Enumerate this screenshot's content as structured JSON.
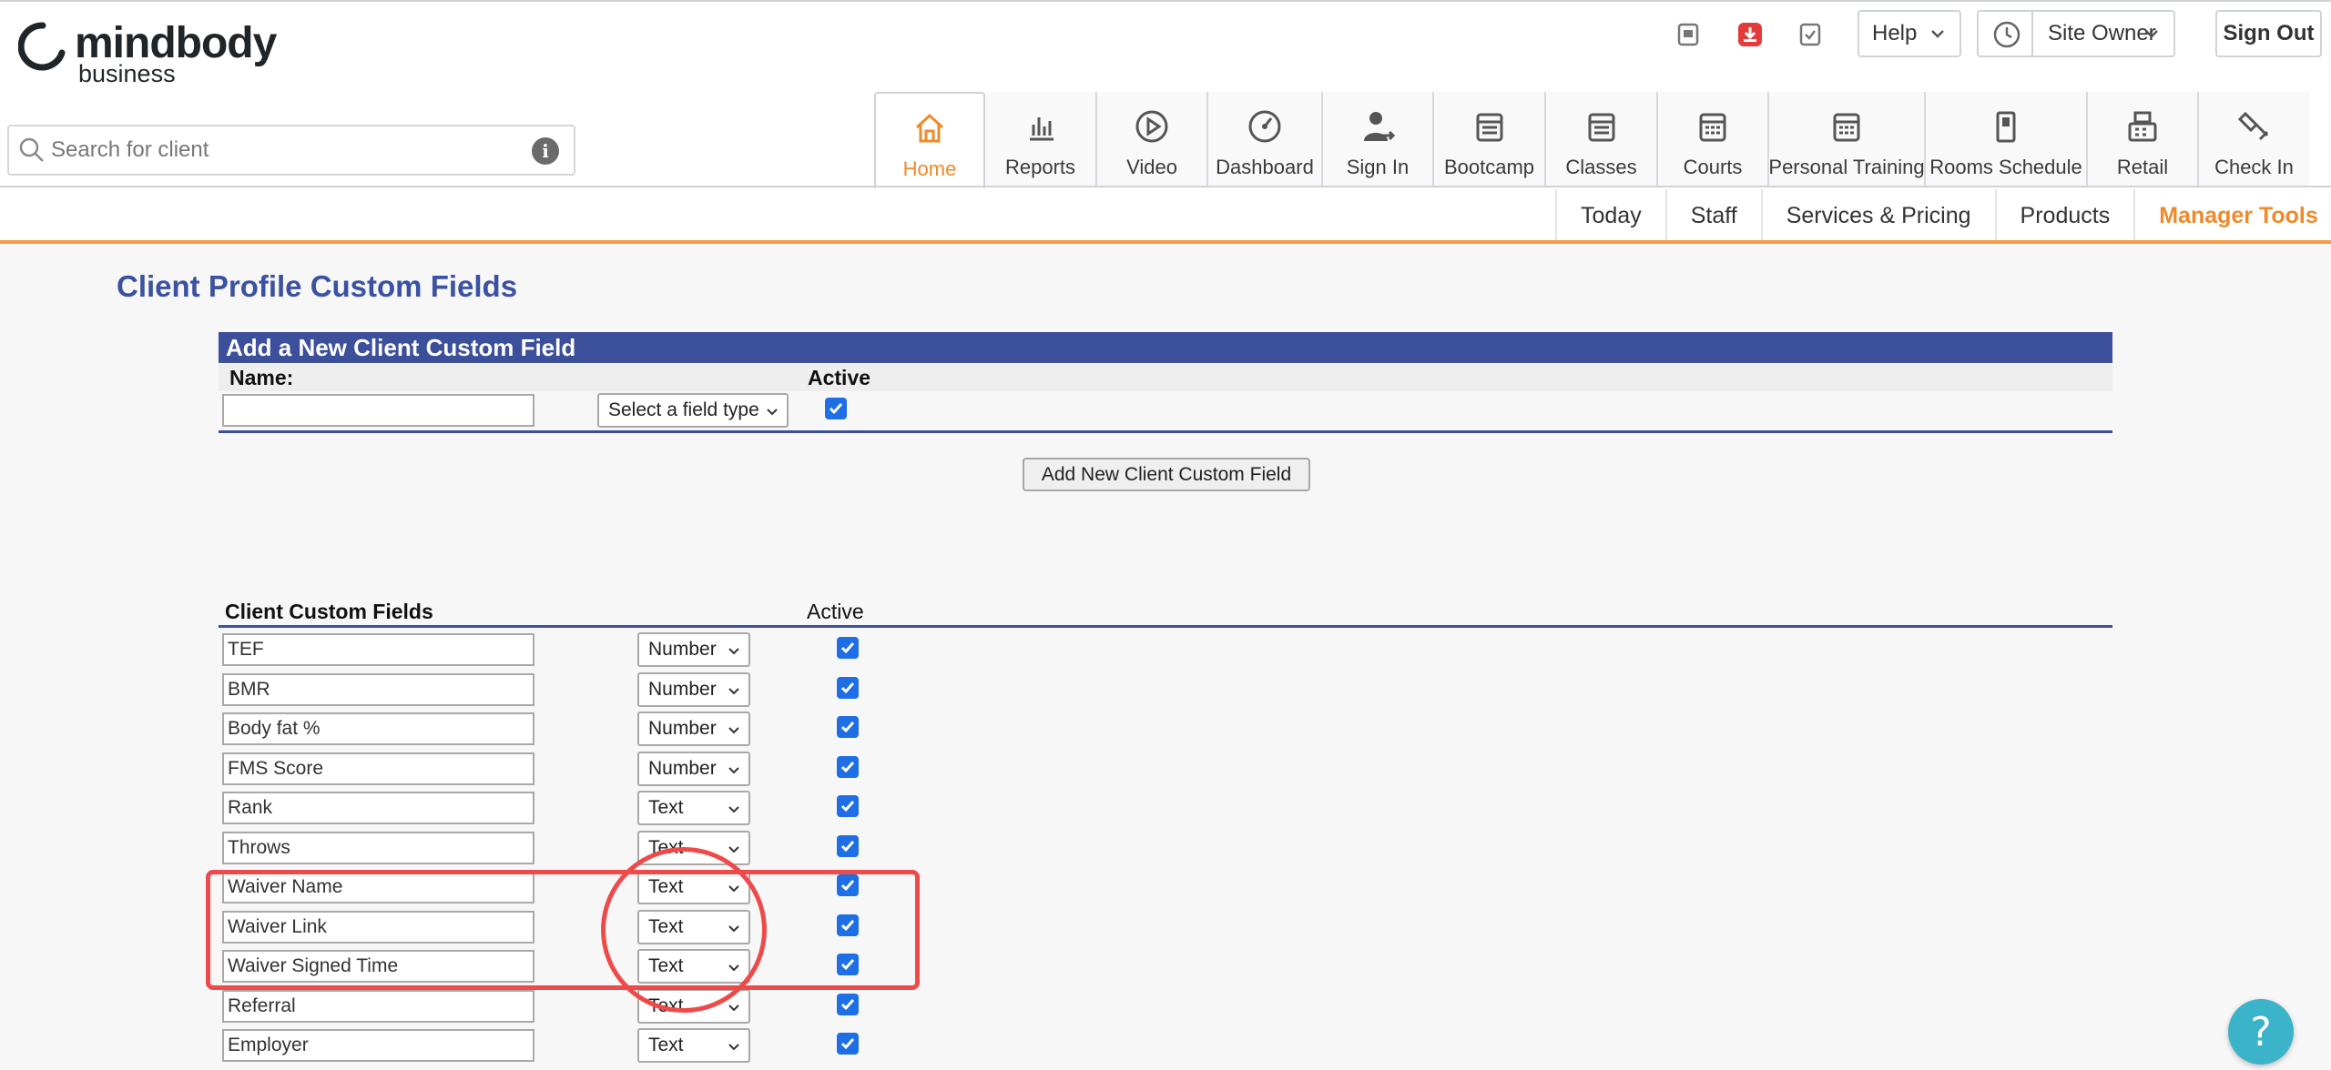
{
  "brand": {
    "name": "mindbody",
    "sub": "business"
  },
  "topbar": {
    "help_label": "Help",
    "site_owner_label": "Site Owner",
    "sign_out_label": "Sign Out",
    "icons": [
      "notes-icon",
      "alert-download-icon",
      "checklist-icon"
    ]
  },
  "search": {
    "placeholder": "Search for client"
  },
  "main_tabs": [
    {
      "label": "Home",
      "icon": "home-icon",
      "active": true
    },
    {
      "label": "Reports",
      "icon": "bar-chart-icon"
    },
    {
      "label": "Video",
      "icon": "play-icon"
    },
    {
      "label": "Dashboard",
      "icon": "gauge-icon"
    },
    {
      "label": "Sign In",
      "icon": "person-arrow-icon"
    },
    {
      "label": "Bootcamp",
      "icon": "calendar-icon"
    },
    {
      "label": "Classes",
      "icon": "calendar-icon"
    },
    {
      "label": "Courts",
      "icon": "calendar-grid-icon"
    },
    {
      "label": "Personal Training",
      "icon": "calendar-grid-icon"
    },
    {
      "label": "Rooms Schedule",
      "icon": "door-icon"
    },
    {
      "label": "Retail",
      "icon": "register-icon"
    },
    {
      "label": "Check In",
      "icon": "tag-icon"
    }
  ],
  "sub_tabs": [
    {
      "label": "Today"
    },
    {
      "label": "Staff"
    },
    {
      "label": "Services & Pricing"
    },
    {
      "label": "Products"
    },
    {
      "label": "Manager Tools",
      "active": true
    }
  ],
  "page": {
    "title": "Client Profile Custom Fields"
  },
  "add_form": {
    "header": "Add a New Client Custom Field",
    "name_label": "Name:",
    "active_label": "Active",
    "name_value": "",
    "type_placeholder": "Select a field type",
    "active_checked": true,
    "add_button_label": "Add New Client Custom Field"
  },
  "list": {
    "title": "Client Custom Fields",
    "active_label": "Active",
    "fields": [
      {
        "name": "TEF",
        "type": "Number",
        "active": true
      },
      {
        "name": "BMR",
        "type": "Number",
        "active": true
      },
      {
        "name": "Body fat %",
        "type": "Number",
        "active": true
      },
      {
        "name": "FMS Score",
        "type": "Number",
        "active": true
      },
      {
        "name": "Rank",
        "type": "Text",
        "active": true
      },
      {
        "name": "Throws",
        "type": "Text",
        "active": true
      },
      {
        "name": "Waiver Name",
        "type": "Text",
        "active": true
      },
      {
        "name": "Waiver Link",
        "type": "Text",
        "active": true
      },
      {
        "name": "Waiver Signed Time",
        "type": "Text",
        "active": true
      },
      {
        "name": "Referral",
        "type": "Text",
        "active": true
      },
      {
        "name": "Employer",
        "type": "Text",
        "active": true
      }
    ]
  },
  "help_fab": {
    "label": "?"
  },
  "colors": {
    "accent": "#ee8a2a",
    "navy": "#3c4f9b",
    "title_blue": "#3b52a3",
    "checkbox": "#1e6fe6",
    "annotation_red": "#ef4a4a",
    "fab": "#3bb3c8"
  }
}
